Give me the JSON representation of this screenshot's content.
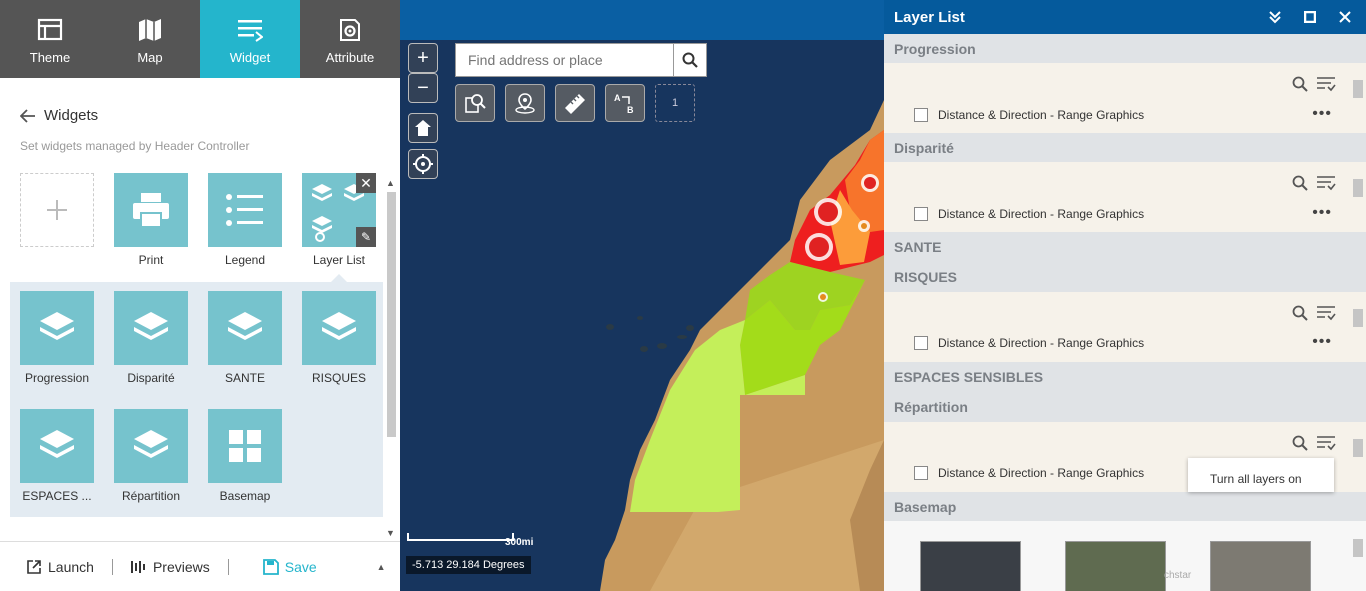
{
  "tabs": [
    {
      "label": "Theme",
      "icon": "theme-icon"
    },
    {
      "label": "Map",
      "icon": "map-icon"
    },
    {
      "label": "Widget",
      "icon": "widget-icon"
    },
    {
      "label": "Attribute",
      "icon": "attribute-icon"
    }
  ],
  "active_tab": "Widget",
  "widgets_panel": {
    "title": "Widgets",
    "subtitle": "Set widgets managed by Header Controller",
    "top_widgets": [
      {
        "label": "Print",
        "icon": "printer-icon"
      },
      {
        "label": "Legend",
        "icon": "legend-icon"
      },
      {
        "label": "Layer List",
        "icon": "layers-group-icon"
      }
    ],
    "group_widgets": [
      {
        "label": "Progression",
        "icon": "layers-icon"
      },
      {
        "label": "Disparité",
        "icon": "layers-icon"
      },
      {
        "label": "SANTE",
        "icon": "layers-icon"
      },
      {
        "label": "RISQUES",
        "icon": "layers-icon"
      },
      {
        "label": "ESPACES ...",
        "icon": "layers-icon"
      },
      {
        "label": "Répartition",
        "icon": "layers-icon"
      },
      {
        "label": "Basemap",
        "icon": "grid-icon"
      }
    ]
  },
  "footer": {
    "launch": "Launch",
    "previews": "Previews",
    "save": "Save"
  },
  "map": {
    "search_placeholder": "Find address or place",
    "zoom_in": "+",
    "zoom_out": "−",
    "toolbar_count": "1",
    "scale_label": "300mi",
    "coordinates": "-5.713 29.184 Degrees",
    "attribution": "chstar"
  },
  "layer_panel": {
    "title": "Layer List",
    "sections": [
      {
        "name": "Progression",
        "layer": "Distance & Direction - Range Graphics"
      },
      {
        "name": "Disparité",
        "layer": "Distance & Direction - Range Graphics"
      },
      {
        "name": "SANTE",
        "layer": null
      },
      {
        "name": "RISQUES",
        "layer": "Distance & Direction - Range Graphics"
      },
      {
        "name": "ESPACES SENSIBLES",
        "layer": null
      },
      {
        "name": "Répartition",
        "layer": "Distance & Direction - Range Graphics"
      },
      {
        "name": "Basemap",
        "layer": null
      }
    ],
    "menu_item": "Turn all layers on"
  },
  "colors": {
    "tab_bar": "#555555",
    "active_tab": "#24b5cc",
    "widget_tile": "#76c3cd",
    "panel_header": "#055a9c",
    "save_accent": "#24b5cc"
  }
}
